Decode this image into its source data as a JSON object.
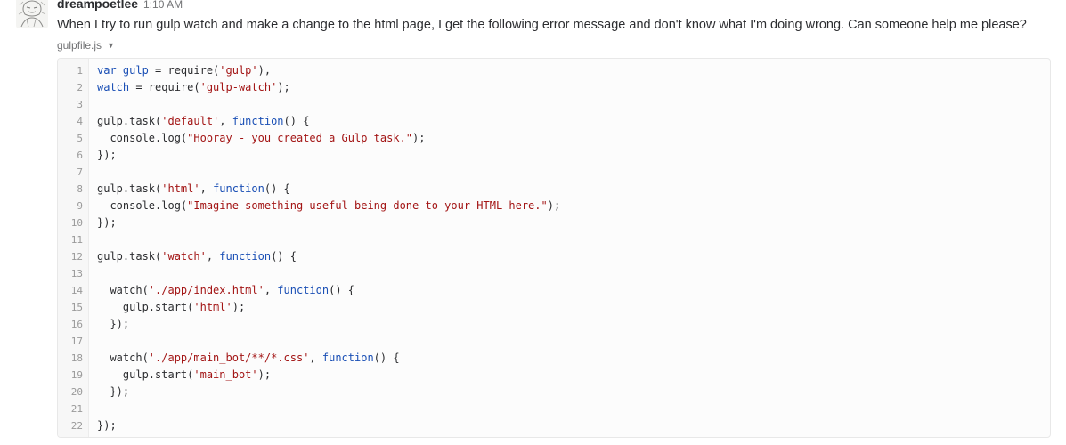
{
  "message": {
    "author": "dreampoetlee",
    "time": "1:10 AM",
    "text": "When I try to run gulp watch and make a change to the html page, I get the following error message and don't know what I'm doing wrong. Can someone help me please?"
  },
  "snippet": {
    "filename": "gulpfile.js",
    "lines": [
      {
        "n": "1",
        "tokens": [
          {
            "t": "var gulp",
            "c": "kw"
          },
          {
            "t": " = require(",
            "c": "plain"
          },
          {
            "t": "'gulp'",
            "c": "str"
          },
          {
            "t": "),",
            "c": "plain"
          }
        ]
      },
      {
        "n": "2",
        "tokens": [
          {
            "t": "watch",
            "c": "kw"
          },
          {
            "t": " = require(",
            "c": "plain"
          },
          {
            "t": "'gulp-watch'",
            "c": "str"
          },
          {
            "t": ");",
            "c": "plain"
          }
        ]
      },
      {
        "n": "3",
        "tokens": []
      },
      {
        "n": "4",
        "tokens": [
          {
            "t": "gulp.task(",
            "c": "plain"
          },
          {
            "t": "'default'",
            "c": "str"
          },
          {
            "t": ", ",
            "c": "plain"
          },
          {
            "t": "function",
            "c": "kw"
          },
          {
            "t": "() {",
            "c": "plain"
          }
        ]
      },
      {
        "n": "5",
        "tokens": [
          {
            "t": "  console.log(",
            "c": "plain"
          },
          {
            "t": "\"Hooray - you created a Gulp task.\"",
            "c": "str"
          },
          {
            "t": ");",
            "c": "plain"
          }
        ]
      },
      {
        "n": "6",
        "tokens": [
          {
            "t": "});",
            "c": "plain"
          }
        ]
      },
      {
        "n": "7",
        "tokens": []
      },
      {
        "n": "8",
        "tokens": [
          {
            "t": "gulp.task(",
            "c": "plain"
          },
          {
            "t": "'html'",
            "c": "str"
          },
          {
            "t": ", ",
            "c": "plain"
          },
          {
            "t": "function",
            "c": "kw"
          },
          {
            "t": "() {",
            "c": "plain"
          }
        ]
      },
      {
        "n": "9",
        "tokens": [
          {
            "t": "  console.log(",
            "c": "plain"
          },
          {
            "t": "\"Imagine something useful being done to your HTML here.\"",
            "c": "str"
          },
          {
            "t": ");",
            "c": "plain"
          }
        ]
      },
      {
        "n": "10",
        "tokens": [
          {
            "t": "});",
            "c": "plain"
          }
        ]
      },
      {
        "n": "11",
        "tokens": []
      },
      {
        "n": "12",
        "tokens": [
          {
            "t": "gulp.task(",
            "c": "plain"
          },
          {
            "t": "'watch'",
            "c": "str"
          },
          {
            "t": ", ",
            "c": "plain"
          },
          {
            "t": "function",
            "c": "kw"
          },
          {
            "t": "() {",
            "c": "plain"
          }
        ]
      },
      {
        "n": "13",
        "tokens": []
      },
      {
        "n": "14",
        "tokens": [
          {
            "t": "  watch(",
            "c": "plain"
          },
          {
            "t": "'./app/index.html'",
            "c": "str"
          },
          {
            "t": ", ",
            "c": "plain"
          },
          {
            "t": "function",
            "c": "kw"
          },
          {
            "t": "() {",
            "c": "plain"
          }
        ]
      },
      {
        "n": "15",
        "tokens": [
          {
            "t": "    gulp.start(",
            "c": "plain"
          },
          {
            "t": "'html'",
            "c": "str"
          },
          {
            "t": ");",
            "c": "plain"
          }
        ]
      },
      {
        "n": "16",
        "tokens": [
          {
            "t": "  });",
            "c": "plain"
          }
        ]
      },
      {
        "n": "17",
        "tokens": []
      },
      {
        "n": "18",
        "tokens": [
          {
            "t": "  watch(",
            "c": "plain"
          },
          {
            "t": "'./app/main_bot/**/*.css'",
            "c": "str"
          },
          {
            "t": ", ",
            "c": "plain"
          },
          {
            "t": "function",
            "c": "kw"
          },
          {
            "t": "() {",
            "c": "plain"
          }
        ]
      },
      {
        "n": "19",
        "tokens": [
          {
            "t": "    gulp.start(",
            "c": "plain"
          },
          {
            "t": "'main_bot'",
            "c": "str"
          },
          {
            "t": ");",
            "c": "plain"
          }
        ]
      },
      {
        "n": "20",
        "tokens": [
          {
            "t": "  });",
            "c": "plain"
          }
        ]
      },
      {
        "n": "21",
        "tokens": []
      },
      {
        "n": "22",
        "tokens": [
          {
            "t": "});",
            "c": "plain"
          }
        ]
      }
    ]
  },
  "colors": {
    "keyword": "#1a4fb5",
    "string": "#a31515",
    "text": "#2c2d30",
    "muted": "#717274"
  },
  "icons": {
    "avatar": "sketch-portrait-avatar",
    "file_menu": "caret-down-icon"
  }
}
